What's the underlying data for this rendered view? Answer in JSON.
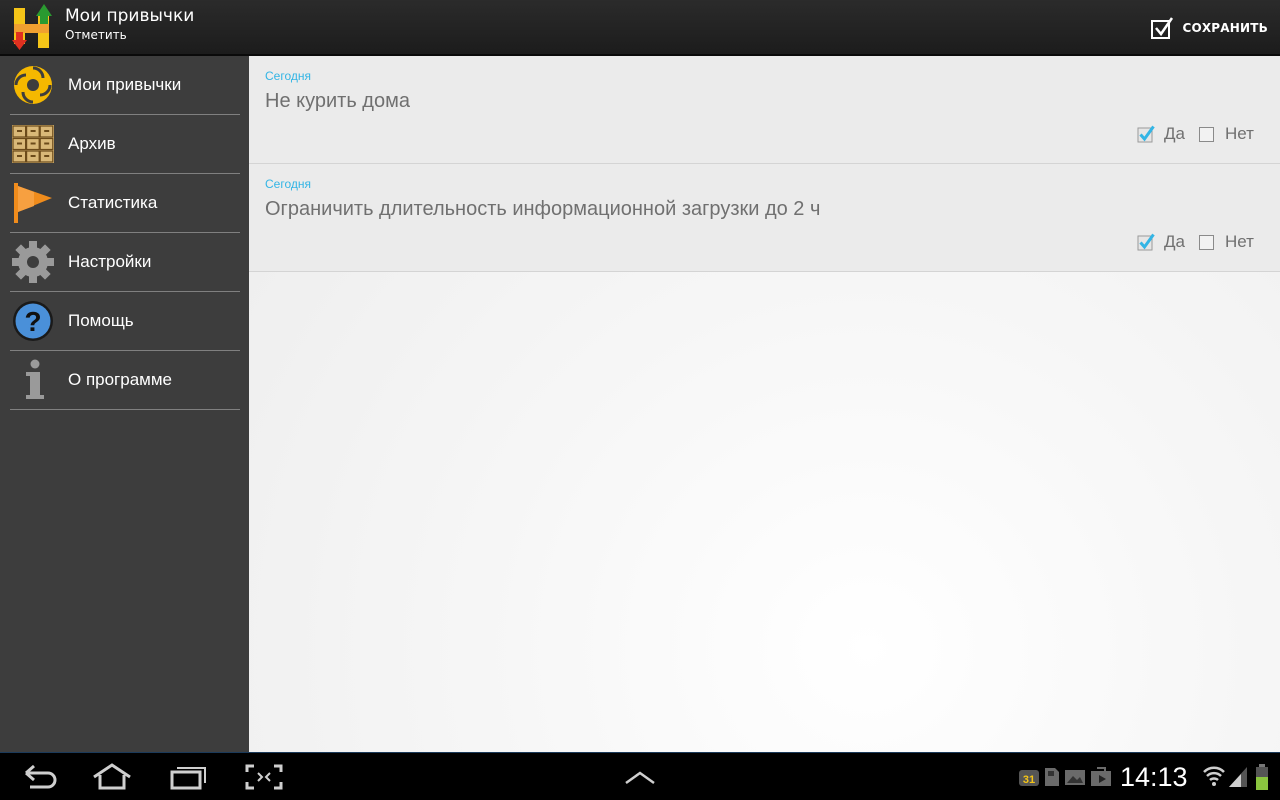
{
  "actionbar": {
    "title": "Мои привычки",
    "subtitle": "Отметить",
    "save_label": "СОХРАНИТЬ",
    "logo_icon": "habit-h-logo"
  },
  "sidebar": {
    "items": [
      {
        "label": "Мои привычки",
        "icon": "habits-swirl-icon"
      },
      {
        "label": "Архив",
        "icon": "archive-cabinet-icon"
      },
      {
        "label": "Статистика",
        "icon": "flag-icon"
      },
      {
        "label": "Настройки",
        "icon": "gear-icon"
      },
      {
        "label": "Помощь",
        "icon": "help-icon"
      },
      {
        "label": "О программе",
        "icon": "info-icon"
      }
    ]
  },
  "habits": [
    {
      "date": "Сегодня",
      "name": "Не курить дома",
      "yes_label": "Да",
      "no_label": "Нет",
      "yes_checked": true,
      "no_checked": false
    },
    {
      "date": "Сегодня",
      "name": "Ограничить длительность информационной загрузки до 2 ч",
      "yes_label": "Да",
      "no_label": "Нет",
      "yes_checked": true,
      "no_checked": false
    }
  ],
  "status_bar": {
    "time": "14:13",
    "calendar_day": "31"
  },
  "colors": {
    "accent": "#33b5e5",
    "sidebar_bg": "#3d3d3d",
    "actionbar_bg": "#222222"
  }
}
